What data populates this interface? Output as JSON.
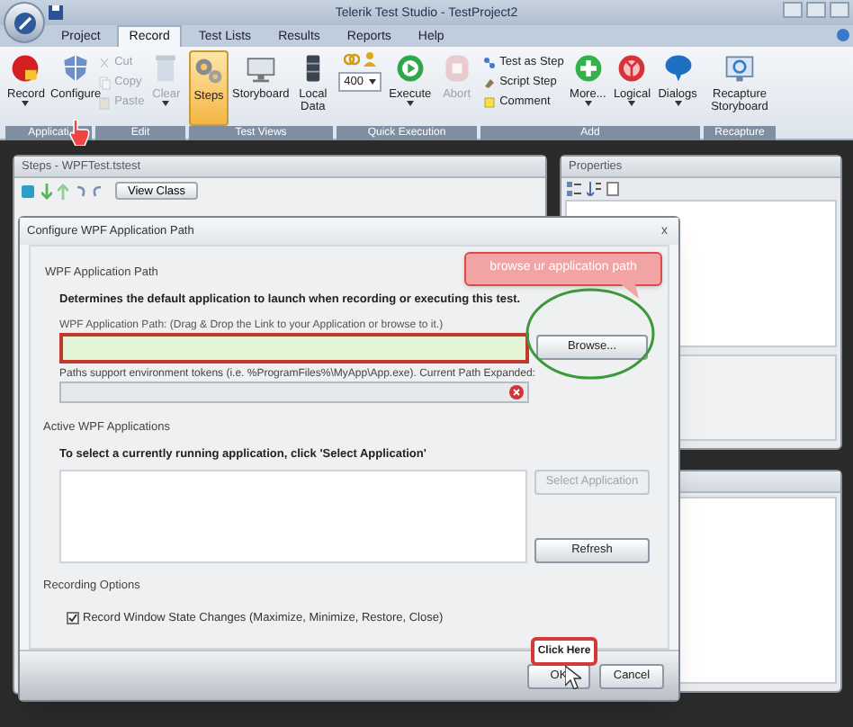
{
  "app": {
    "title": "Telerik Test Studio - TestProject2"
  },
  "ribbon_tabs": [
    {
      "label": "Project",
      "selected": false
    },
    {
      "label": "Record",
      "selected": true
    },
    {
      "label": "Test Lists",
      "selected": false
    },
    {
      "label": "Results",
      "selected": false
    },
    {
      "label": "Reports",
      "selected": false
    },
    {
      "label": "Help",
      "selected": false
    }
  ],
  "ribbon_groups": [
    {
      "label": "Applicati",
      "items": [
        {
          "label": "Record",
          "kind": "large",
          "dropdown": true,
          "disabled": false
        },
        {
          "label": "Configure",
          "kind": "large",
          "dropdown": false,
          "disabled": false
        }
      ]
    },
    {
      "label": "Edit",
      "items": [
        {
          "label": "Cut",
          "kind": "small",
          "disabled": true
        },
        {
          "label": "Copy",
          "kind": "small",
          "disabled": true
        },
        {
          "label": "Paste",
          "kind": "small",
          "disabled": true
        },
        {
          "label": "Clear",
          "kind": "large",
          "dropdown": true,
          "disabled": true
        }
      ]
    },
    {
      "label": "Test Views",
      "items": [
        {
          "label": "Steps",
          "kind": "large",
          "dropdown": false,
          "disabled": false,
          "selected": true
        },
        {
          "label": "Storyboard",
          "kind": "large",
          "dropdown": false,
          "disabled": false,
          "selected": false
        },
        {
          "label": "Local Data",
          "kind": "large",
          "dropdown": false,
          "disabled": false,
          "selected": false
        }
      ]
    },
    {
      "label": "Quick Execution",
      "items": [
        {
          "label": "400",
          "kind": "combo",
          "disabled": false
        },
        {
          "label": "Execute",
          "kind": "large",
          "dropdown": true,
          "disabled": false
        },
        {
          "label": "Abort",
          "kind": "large",
          "dropdown": false,
          "disabled": true
        }
      ]
    },
    {
      "label": "Add",
      "items": [
        {
          "label": "Test as Step",
          "kind": "small",
          "disabled": false
        },
        {
          "label": "Script Step",
          "kind": "small",
          "disabled": false
        },
        {
          "label": "Comment",
          "kind": "small",
          "disabled": false
        },
        {
          "label": "More...",
          "kind": "large",
          "dropdown": true,
          "disabled": false
        },
        {
          "label": "Logical",
          "kind": "large",
          "dropdown": true,
          "disabled": false
        },
        {
          "label": "Dialogs",
          "kind": "large",
          "dropdown": true,
          "disabled": false
        }
      ]
    },
    {
      "label": "Recapture",
      "items": [
        {
          "label": "Recapture Storyboard",
          "kind": "large",
          "dropdown": false,
          "disabled": false
        }
      ]
    }
  ],
  "steps_panel": {
    "title": "Steps - WPFTest.tstest",
    "button": "View Class"
  },
  "properties_panel": {
    "title": "Properties"
  },
  "dialog": {
    "title": "Configure WPF Application Path",
    "close": "x",
    "path_section": {
      "heading": "WPF Application Path",
      "description": "Determines the default application to launch when recording or executing this test.",
      "field_label": "WPF Application Path: (Drag & Drop the Link to your Application or browse to it.)",
      "browse_button": "Browse...",
      "tokens_note": "Paths support environment tokens (i.e. %ProgramFiles%\\MyApp\\App.exe). Current Path Expanded:"
    },
    "active_section": {
      "heading": "Active WPF Applications",
      "description": "To select a currently running application, click 'Select Application'",
      "select_button": {
        "label": "Select Application",
        "disabled": true
      },
      "refresh_button": {
        "label": "Refresh",
        "disabled": false
      }
    },
    "recording_section": {
      "heading": "Recording Options",
      "options": [
        {
          "label": "Record Window State Changes (Maximize, Minimize, Restore, Close)",
          "checked": true
        }
      ]
    },
    "buttons": [
      "OK",
      "Cancel"
    ]
  },
  "callouts": [
    {
      "text": "browse ur application path"
    },
    {
      "text": "Click Here"
    }
  ]
}
